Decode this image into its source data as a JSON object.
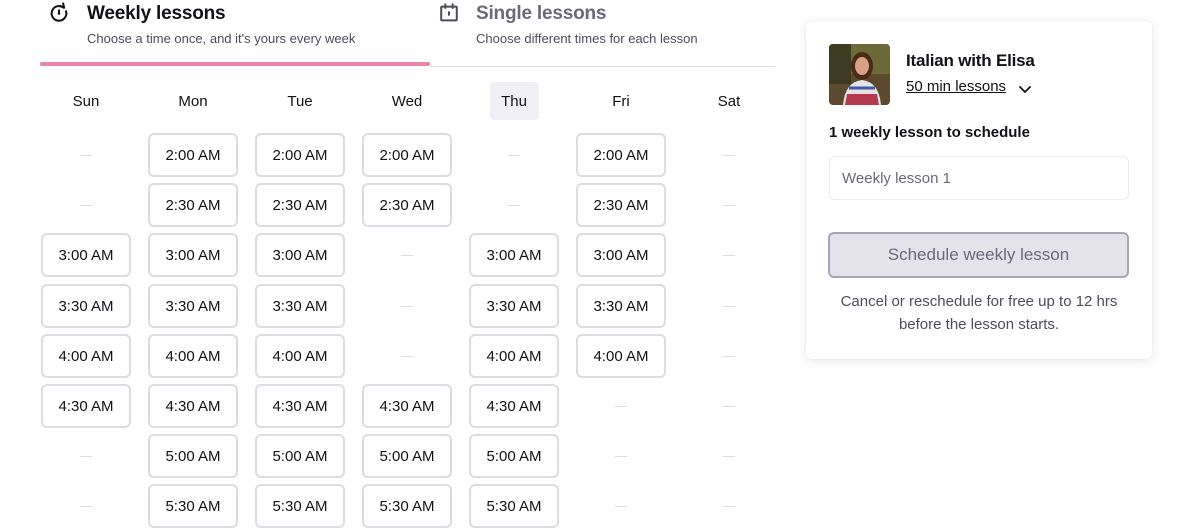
{
  "tabs": [
    {
      "icon": "recurring-icon",
      "title": "Weekly lessons",
      "subtitle": "Choose a time once, and it's yours every week",
      "active": true
    },
    {
      "icon": "calendar-icon",
      "title": "Single lessons",
      "subtitle": "Choose different times for each lesson",
      "active": false
    }
  ],
  "calendar": {
    "highlighted_day": "Thu",
    "days": [
      {
        "label": "Sun",
        "slots": [
          "",
          "",
          "3:00 AM",
          "3:30 AM",
          "4:00 AM",
          "4:30 AM",
          "",
          ""
        ]
      },
      {
        "label": "Mon",
        "slots": [
          "2:00 AM",
          "2:30 AM",
          "3:00 AM",
          "3:30 AM",
          "4:00 AM",
          "4:30 AM",
          "5:00 AM",
          "5:30 AM"
        ]
      },
      {
        "label": "Tue",
        "slots": [
          "2:00 AM",
          "2:30 AM",
          "3:00 AM",
          "3:30 AM",
          "4:00 AM",
          "4:30 AM",
          "5:00 AM",
          "5:30 AM"
        ]
      },
      {
        "label": "Wed",
        "slots": [
          "2:00 AM",
          "2:30 AM",
          "",
          "",
          "",
          "4:30 AM",
          "5:00 AM",
          "5:30 AM"
        ]
      },
      {
        "label": "Thu",
        "slots": [
          "",
          "",
          "3:00 AM",
          "3:30 AM",
          "4:00 AM",
          "4:30 AM",
          "5:00 AM",
          "5:30 AM"
        ]
      },
      {
        "label": "Fri",
        "slots": [
          "2:00 AM",
          "2:30 AM",
          "3:00 AM",
          "3:30 AM",
          "4:00 AM",
          "",
          "",
          ""
        ]
      },
      {
        "label": "Sat",
        "slots": [
          "",
          "",
          "",
          "",
          "",
          "",
          "",
          ""
        ]
      }
    ]
  },
  "booking": {
    "tutor_name": "Italian with Elisa",
    "duration": "50 min lessons",
    "schedule_label": "1 weekly lesson to schedule",
    "lesson_placeholder": "Weekly lesson 1",
    "button_label": "Schedule weekly lesson",
    "button_disabled": true,
    "note": "Cancel or reschedule for free up to 12 hrs before the lesson starts."
  },
  "colors": {
    "active_tab_underline": "#ec83ad",
    "slot_border": "#dcdce5",
    "today_header_bg": "#f0eff5",
    "disabled_button_bg": "#e4e3ea"
  }
}
